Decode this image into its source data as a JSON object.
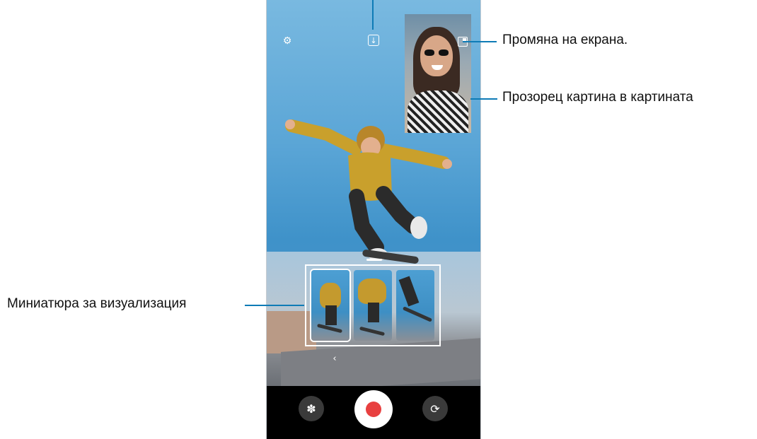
{
  "callouts": {
    "switch_screen": "Промяна на екрана.",
    "pip_window": "Прозорец картина в картината",
    "preview_thumbnail": "Миниатюра за визуализация"
  },
  "icons": {
    "settings": "gear-icon",
    "save": "download-icon",
    "switch_screen": "switch-screen-icon",
    "back": "chevron-left-icon",
    "effects": "effects-icon",
    "record": "record-icon",
    "flip": "camera-flip-icon"
  },
  "colors": {
    "accent_line": "#0e7bb6",
    "record": "#e84040"
  },
  "thumbnails": [
    {
      "state": "selected"
    },
    {
      "state": "normal"
    },
    {
      "state": "normal"
    }
  ]
}
